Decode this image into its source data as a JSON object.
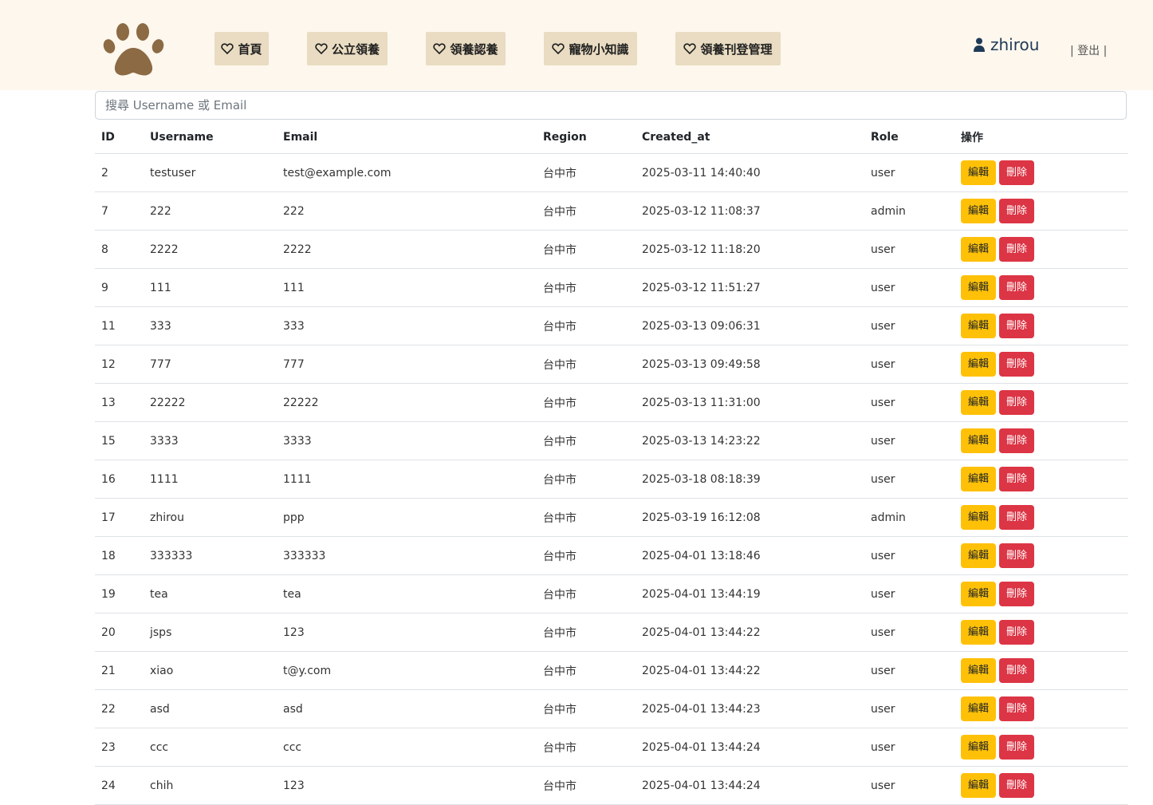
{
  "nav": {
    "items": [
      "首頁",
      "公立領養",
      "領養認養",
      "寵物小知識",
      "領養刊登管理"
    ],
    "username": "zhirou",
    "logout": "| 登出 |"
  },
  "search": {
    "placeholder": "搜尋 Username 或 Email"
  },
  "table": {
    "headers": [
      "ID",
      "Username",
      "Email",
      "Region",
      "Created_at",
      "Role",
      "操作"
    ],
    "edit_label": "編輯",
    "delete_label": "刪除",
    "rows": [
      [
        "2",
        "testuser",
        "test@example.com",
        "台中市",
        "2025-03-11 14:40:40",
        "user"
      ],
      [
        "7",
        "222",
        "222",
        "台中市",
        "2025-03-12 11:08:37",
        "admin"
      ],
      [
        "8",
        "2222",
        "2222",
        "台中市",
        "2025-03-12 11:18:20",
        "user"
      ],
      [
        "9",
        "111",
        "111",
        "台中市",
        "2025-03-12 11:51:27",
        "user"
      ],
      [
        "11",
        "333",
        "333",
        "台中市",
        "2025-03-13 09:06:31",
        "user"
      ],
      [
        "12",
        "777",
        "777",
        "台中市",
        "2025-03-13 09:49:58",
        "user"
      ],
      [
        "13",
        "22222",
        "22222",
        "台中市",
        "2025-03-13 11:31:00",
        "user"
      ],
      [
        "15",
        "3333",
        "3333",
        "台中市",
        "2025-03-13 14:23:22",
        "user"
      ],
      [
        "16",
        "1111",
        "1111",
        "台中市",
        "2025-03-18 08:18:39",
        "user"
      ],
      [
        "17",
        "zhirou",
        "ppp",
        "台中市",
        "2025-03-19 16:12:08",
        "admin"
      ],
      [
        "18",
        "333333",
        "333333",
        "台中市",
        "2025-04-01 13:18:46",
        "user"
      ],
      [
        "19",
        "tea",
        "tea",
        "台中市",
        "2025-04-01 13:44:19",
        "user"
      ],
      [
        "20",
        "jsps",
        "123",
        "台中市",
        "2025-04-01 13:44:22",
        "user"
      ],
      [
        "21",
        "xiao",
        "t@y.com",
        "台中市",
        "2025-04-01 13:44:22",
        "user"
      ],
      [
        "22",
        "asd",
        "asd",
        "台中市",
        "2025-04-01 13:44:23",
        "user"
      ],
      [
        "23",
        "ccc",
        "ccc",
        "台中市",
        "2025-04-01 13:44:24",
        "user"
      ],
      [
        "24",
        "chih",
        "123",
        "台中市",
        "2025-04-01 13:44:24",
        "user"
      ]
    ]
  },
  "colors": {
    "header_bg": "#fdf7ed",
    "nav_btn_bg": "#e9dcc2",
    "paw": "#8b6a44",
    "edit": "#ffc107",
    "delete": "#dc3545"
  }
}
